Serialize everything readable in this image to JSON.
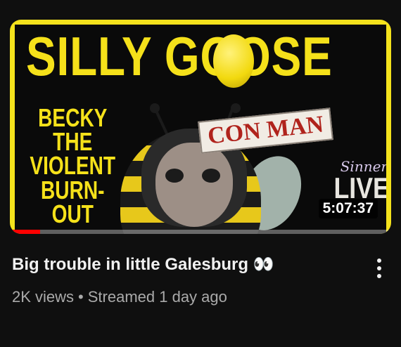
{
  "thumbnail": {
    "headline": "SILLY GOOSE",
    "subhead": "BECKY THE VIOLENT BURN-OUT",
    "sticker": "CON MAN",
    "channel_script": "Sinner",
    "channel_big": "LIVE",
    "duration": "5:07:37",
    "progress_fraction": 0.08,
    "accent_color": "#f5e11a",
    "progress_color": "#ff0000"
  },
  "video": {
    "title": "Big trouble in little Galesburg 👀",
    "views": "2K views",
    "separator": "•",
    "streamed": "Streamed 1 day ago"
  },
  "menu": {
    "icon": "vertical-ellipsis-icon"
  }
}
